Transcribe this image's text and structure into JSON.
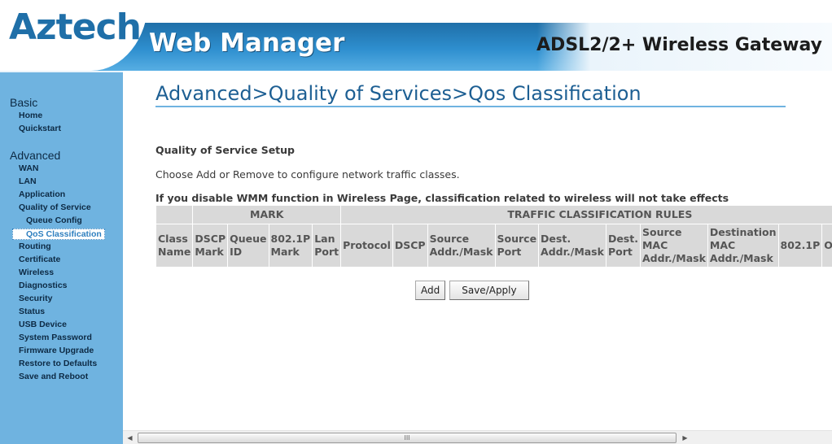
{
  "header": {
    "logo": "Aztech",
    "title": "Web Manager",
    "subtitle": "ADSL2/2+ Wireless Gateway"
  },
  "sidebar": {
    "basic_label": "Basic",
    "basic_items": [
      "Home",
      "Quickstart"
    ],
    "advanced_label": "Advanced",
    "advanced_items": [
      {
        "label": "WAN"
      },
      {
        "label": "LAN"
      },
      {
        "label": "Application"
      },
      {
        "label": "Quality of Service"
      },
      {
        "label": "Queue Config",
        "sub": true
      },
      {
        "label": "QoS Classification",
        "sub": true,
        "active": true
      },
      {
        "label": "Routing"
      },
      {
        "label": "Certificate"
      },
      {
        "label": "Wireless"
      },
      {
        "label": "Diagnostics"
      },
      {
        "label": "Security"
      },
      {
        "label": "Status"
      },
      {
        "label": "USB Device"
      },
      {
        "label": "System Password"
      },
      {
        "label": "Firmware Upgrade"
      },
      {
        "label": "Restore to Defaults"
      },
      {
        "label": "Save and Reboot"
      }
    ]
  },
  "main": {
    "page_title": "Advanced>Quality of Services>Qos Classification",
    "setup_heading": "Quality of Service Setup",
    "instructions": "Choose Add or Remove to configure network traffic classes.",
    "warning": "If you disable WMM function in Wireless Page, classification related to wireless will not take effects",
    "table": {
      "group_mark": "MARK",
      "group_rules": "TRAFFIC CLASSIFICATION RULES",
      "columns": [
        [
          "Class",
          "Name"
        ],
        [
          "DSCP",
          "Mark"
        ],
        [
          "Queue",
          "ID"
        ],
        [
          "802.1P",
          "Mark"
        ],
        [
          "Lan",
          "Port"
        ],
        [
          "Protocol"
        ],
        [
          "DSCP"
        ],
        [
          "Source",
          "Addr./Mask"
        ],
        [
          "Source",
          "Port"
        ],
        [
          "Dest.",
          "Addr./Mask"
        ],
        [
          "Dest.",
          "Port"
        ],
        [
          "Source",
          "MAC",
          "Addr./Mask"
        ],
        [
          "Destination",
          "MAC",
          "Addr./Mask"
        ],
        [
          "802.1P"
        ],
        [
          "Order"
        ]
      ]
    },
    "buttons": {
      "add": "Add",
      "save_apply": "Save/Apply"
    }
  },
  "scrollbar": {
    "grip": "III"
  }
}
